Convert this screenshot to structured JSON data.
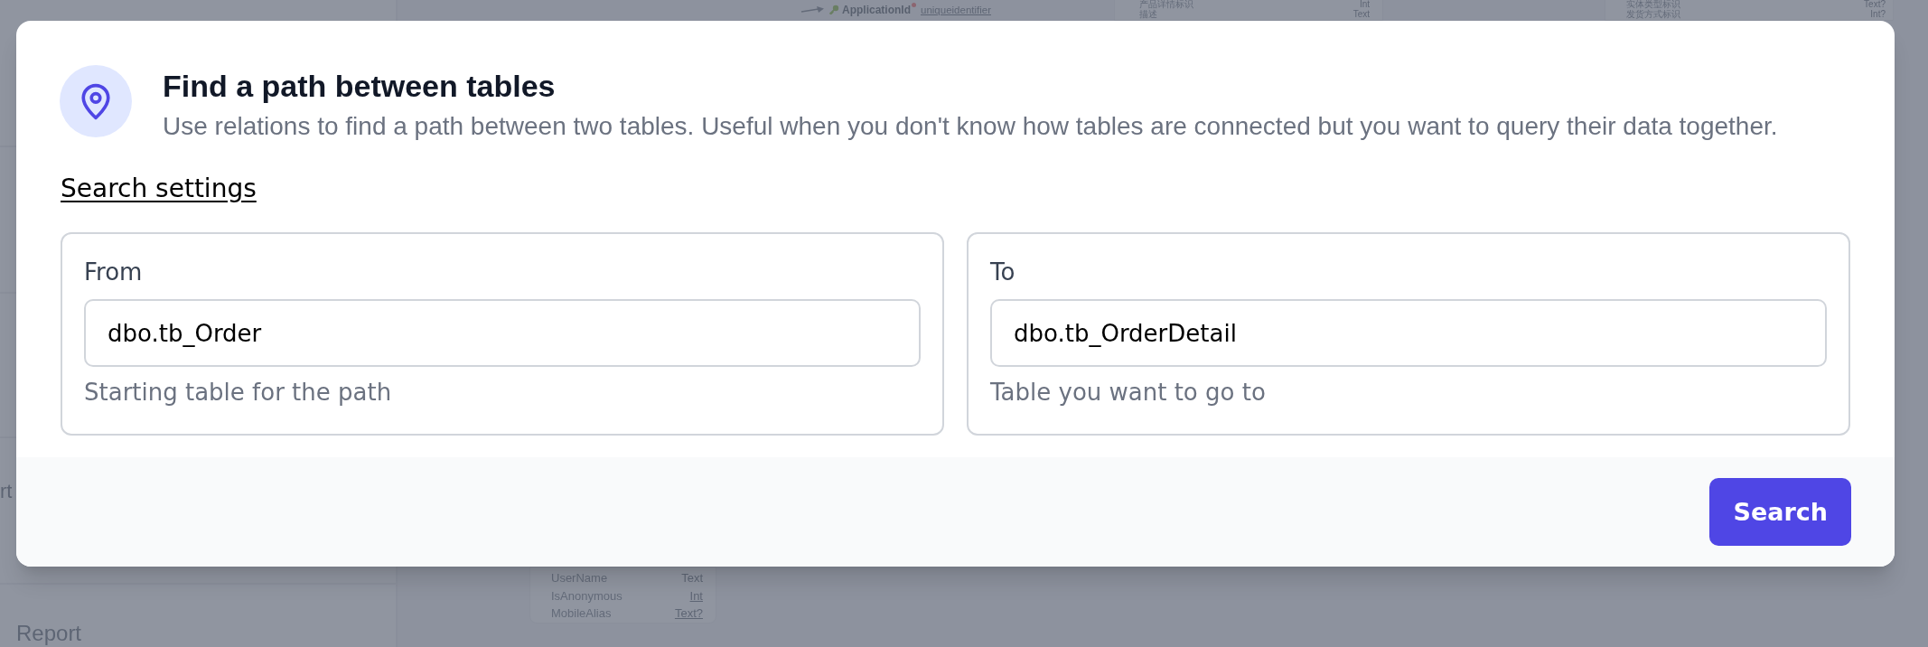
{
  "backdrop": {
    "sidebar_labels": [
      {
        "text": "rt"
      },
      {
        "text": "Report"
      }
    ],
    "relation": {
      "column": "ApplicationId",
      "type": "uniqueidentifier",
      "required": true,
      "linked": true
    },
    "tables": [
      {
        "rows": [
          {
            "name": "产品详情标识",
            "type": "Int",
            "linked": false
          },
          {
            "name": "描述",
            "type": "Text",
            "linked": false
          }
        ]
      },
      {
        "rows": [
          {
            "name": "实体类型标识",
            "type": "Text?",
            "linked": false
          },
          {
            "name": "发货方式标识",
            "type": "Int?",
            "linked": false
          }
        ]
      },
      {
        "rows": [
          {
            "name": "UserName",
            "type": "Text",
            "linked": false
          },
          {
            "name": "IsAnonymous",
            "type": "Int",
            "linked": true
          },
          {
            "name": "MobileAlias",
            "type": "Text?",
            "linked": true
          }
        ]
      }
    ]
  },
  "dialog": {
    "title": "Find a path between tables",
    "description": "Use relations to find a path between two tables. Useful when you don't know how tables are connected but you want to query their data together.",
    "settings_link": "Search settings",
    "fields": [
      {
        "label": "From",
        "value": "dbo.tb_Order",
        "hint": "Starting table for the path"
      },
      {
        "label": "To",
        "value": "dbo.tb_OrderDetail",
        "hint": "Table you want to go to"
      }
    ],
    "button": "Search"
  }
}
